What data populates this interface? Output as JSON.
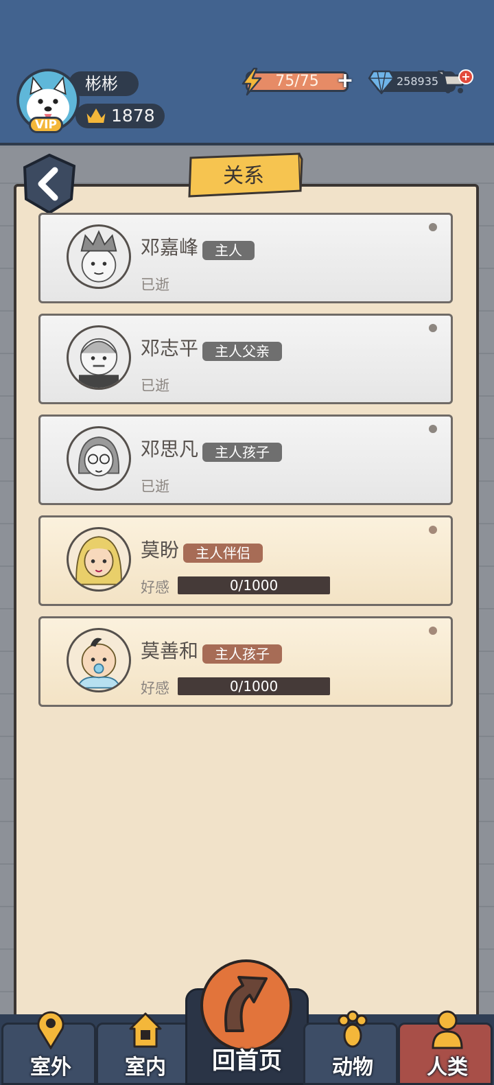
{
  "header": {
    "player_name": "彬彬",
    "crown_score": "1878",
    "vip_label": "VIP",
    "energy": "75/75",
    "energy_plus": "+",
    "gems": "258935",
    "cart_badge": "+"
  },
  "panel": {
    "title": "关系"
  },
  "relations": [
    {
      "name": "邓嘉峰",
      "role": "主人",
      "status": "已逝",
      "deceased": true
    },
    {
      "name": "邓志平",
      "role": "主人父亲",
      "status": "已逝",
      "deceased": true
    },
    {
      "name": "邓思凡",
      "role": "主人孩子",
      "status": "已逝",
      "deceased": true
    },
    {
      "name": "莫盼",
      "role": "主人伴侣",
      "affinity_label": "好感",
      "affinity": "0/1000",
      "affinity_fraction": 0,
      "deceased": false
    },
    {
      "name": "莫善和",
      "role": "主人孩子",
      "affinity_label": "好感",
      "affinity": "0/1000",
      "affinity_fraction": 0,
      "deceased": false
    }
  ],
  "nav": {
    "outdoor": "室外",
    "indoor": "室内",
    "home": "回首页",
    "animals": "动物",
    "humans": "人类",
    "active": "humans"
  },
  "colors": {
    "header_bg": "#42638f",
    "panel_bg": "#f1e2c9",
    "tag_dead": "#6f6f6f",
    "tag_alive": "#a76c56",
    "home_button": "#e2743b"
  }
}
